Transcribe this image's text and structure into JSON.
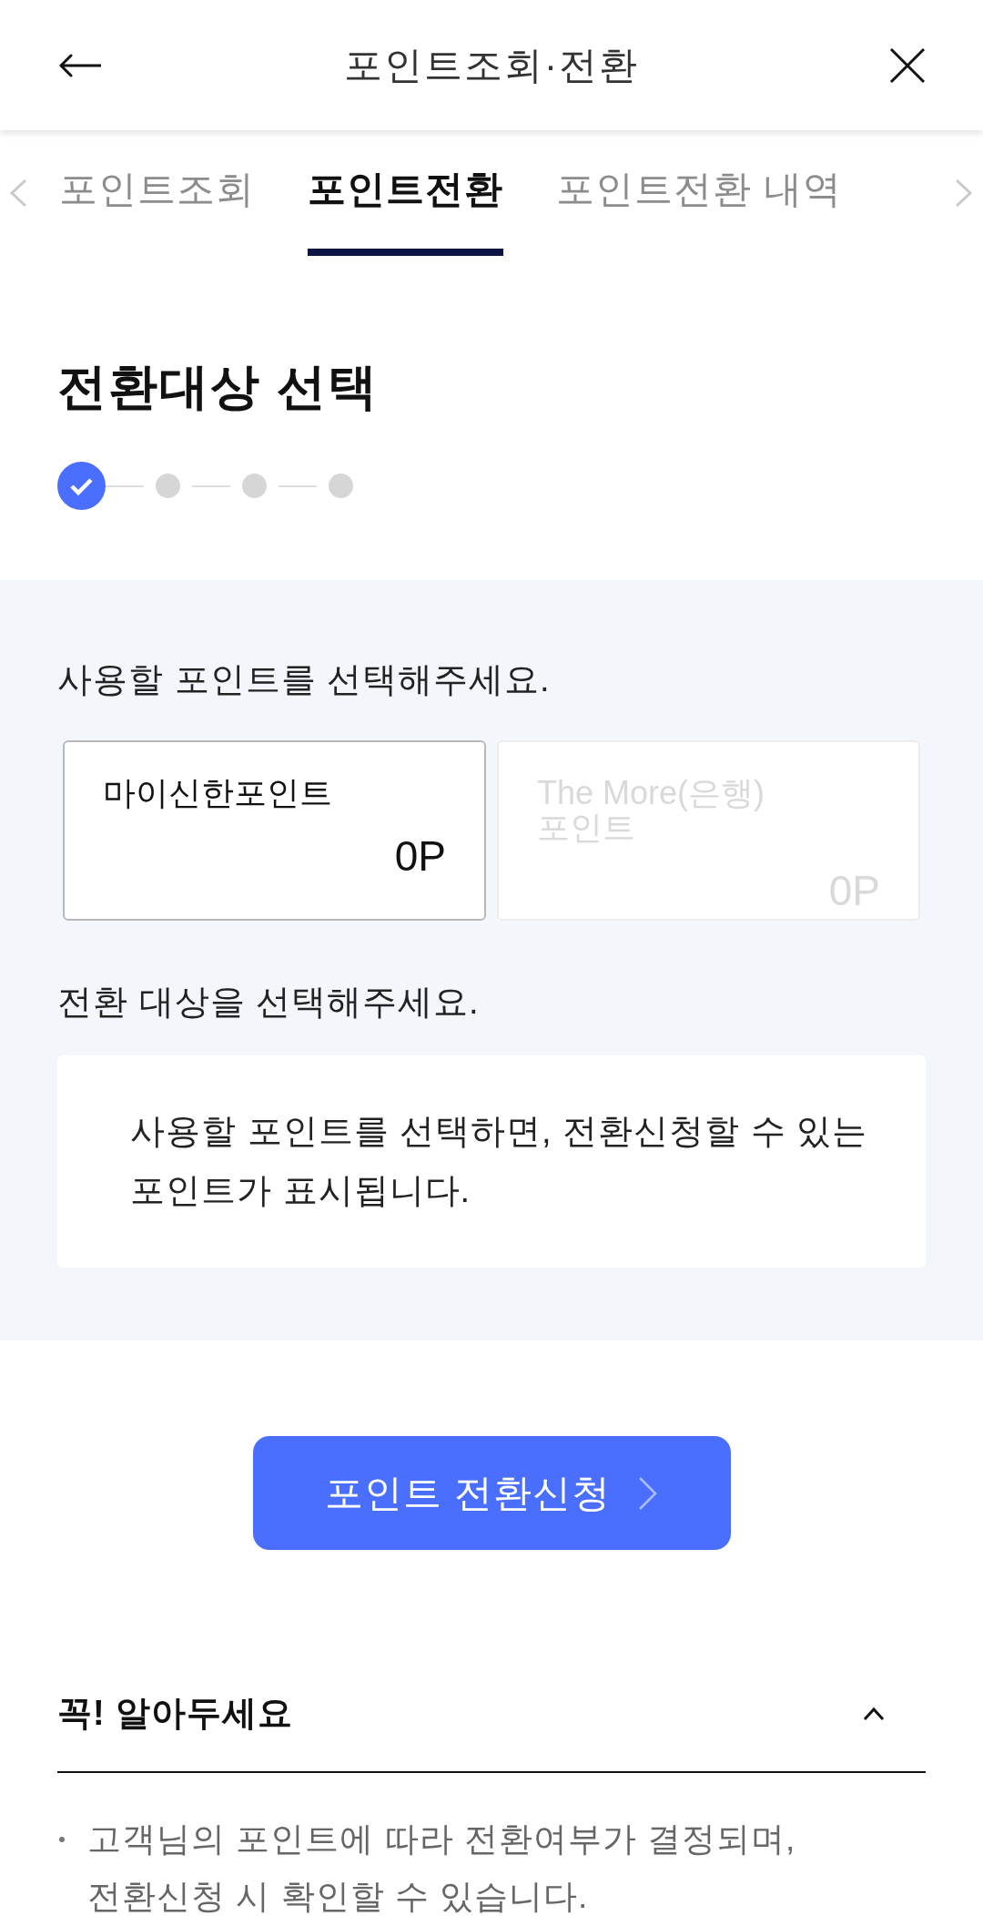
{
  "header": {
    "title": "포인트조회·전환"
  },
  "tabs": [
    {
      "label": "포인트조회",
      "selected": false
    },
    {
      "label": "포인트전환",
      "selected": true
    },
    {
      "label": "포인트전환 내역",
      "selected": false
    }
  ],
  "section_title": "전환대상 선택",
  "steps": [
    {
      "completed": true
    },
    {
      "completed": false
    },
    {
      "completed": false
    },
    {
      "completed": false
    }
  ],
  "point_source": {
    "prompt": "사용할 포인트를 선택해주세요.",
    "options": [
      {
        "label": "마이신한포인트",
        "value": "0P",
        "disabled": false
      },
      {
        "label": "The More(은행) 포인트",
        "value": "0P",
        "disabled": true
      }
    ]
  },
  "target": {
    "prompt": "전환 대상을 선택해주세요.",
    "message": "사용할 포인트를 선택하면, 전환신청할 수 있는 포인트가 표시됩니다."
  },
  "submit_button": {
    "label": "포인트 전환신청"
  },
  "notice": {
    "title": "꼭! 알아두세요",
    "expanded": true,
    "items": [
      "고객님의 포인트에 따라 전환여부가 결정되며, 전환신청 시 확인할 수 있습니다."
    ]
  }
}
